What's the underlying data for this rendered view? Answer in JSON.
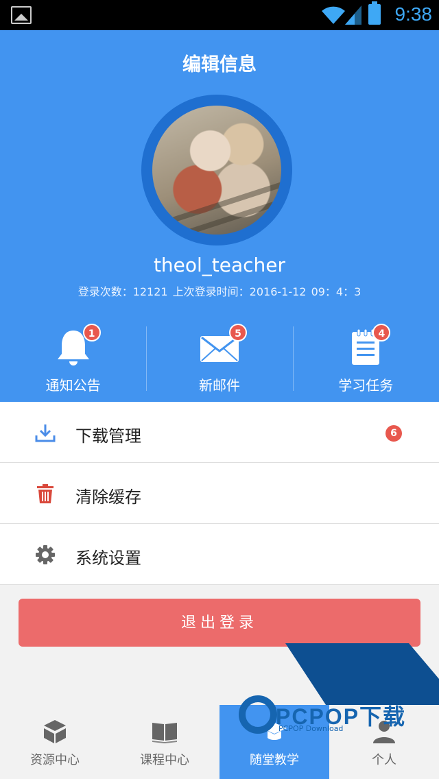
{
  "status_bar": {
    "time": "9:38"
  },
  "header": {
    "title": "编辑信息",
    "username": "theol_teacher",
    "login_info": "登录次数：12121  上次登录时间：2016-1-12 09：4：3"
  },
  "quick_actions": [
    {
      "label": "通知公告",
      "badge": "1",
      "icon": "bell-icon"
    },
    {
      "label": "新邮件",
      "badge": "5",
      "icon": "mail-icon"
    },
    {
      "label": "学习任务",
      "badge": "4",
      "icon": "clipboard-icon"
    }
  ],
  "menu": [
    {
      "label": "下载管理",
      "icon": "download-icon",
      "count": "6"
    },
    {
      "label": "清除缓存",
      "icon": "trash-icon"
    },
    {
      "label": "系统设置",
      "icon": "gear-icon"
    }
  ],
  "logout_label": "退出登录",
  "tabs": [
    {
      "label": "资源中心",
      "icon": "box-icon",
      "active": false
    },
    {
      "label": "课程中心",
      "icon": "book-icon",
      "active": false
    },
    {
      "label": "随堂教学",
      "icon": "graduation-cap-icon",
      "active": true
    },
    {
      "label": "个人",
      "icon": "user-icon",
      "active": false
    }
  ],
  "watermark": {
    "brand": "PCPOP下载",
    "sub": "PCPOP Download"
  },
  "colors": {
    "primary": "#4294f0",
    "danger": "#ec6b6b",
    "badge": "#e8584e",
    "ring": "#1f6fd0"
  }
}
